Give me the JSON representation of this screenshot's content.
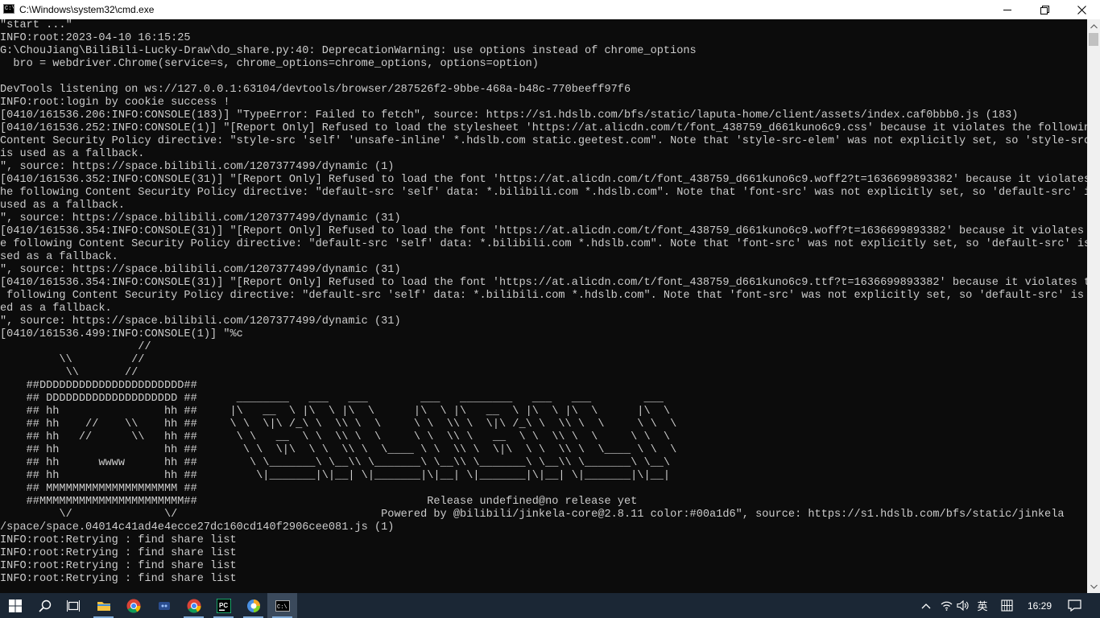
{
  "window": {
    "title": "C:\\Windows\\system32\\cmd.exe",
    "icon": "cmd-console-icon",
    "icon_text": "C:\\"
  },
  "console": {
    "text_color": "#cccccc",
    "background": "#0c0c0c",
    "lines": [
      "\"start ...\"",
      "INFO:root:2023-04-10 16:15:25",
      "G:\\ChouJiang\\BiliBili-Lucky-Draw\\do_share.py:40: DeprecationWarning: use options instead of chrome_options",
      "  bro = webdriver.Chrome(service=s, chrome_options=chrome_options, options=option)",
      "",
      "DevTools listening on ws://127.0.0.1:63104/devtools/browser/287526f2-9bbe-468a-b48c-770beeff97f6",
      "INFO:root:login by cookie success !",
      "[0410/161536.206:INFO:CONSOLE(183)] \"TypeError: Failed to fetch\", source: https://s1.hdslb.com/bfs/static/laputa-home/client/assets/index.caf0bbb0.js (183)",
      "[0410/161536.252:INFO:CONSOLE(1)] \"[Report Only] Refused to load the stylesheet 'https://at.alicdn.com/t/font_438759_d661kuno6c9.css' because it violates the following",
      "Content Security Policy directive: \"style-src 'self' 'unsafe-inline' *.hdslb.com static.geetest.com\". Note that 'style-src-elem' was not explicitly set, so 'style-src'",
      "is used as a fallback.",
      "\", source: https://space.bilibili.com/1207377499/dynamic (1)",
      "[0410/161536.352:INFO:CONSOLE(31)] \"[Report Only] Refused to load the font 'https://at.alicdn.com/t/font_438759_d661kuno6c9.woff2?t=1636699893382' because it violates t",
      "he following Content Security Policy directive: \"default-src 'self' data: *.bilibili.com *.hdslb.com\". Note that 'font-src' was not explicitly set, so 'default-src' is",
      "used as a fallback.",
      "\", source: https://space.bilibili.com/1207377499/dynamic (31)",
      "[0410/161536.354:INFO:CONSOLE(31)] \"[Report Only] Refused to load the font 'https://at.alicdn.com/t/font_438759_d661kuno6c9.woff?t=1636699893382' because it violates th",
      "e following Content Security Policy directive: \"default-src 'self' data: *.bilibili.com *.hdslb.com\". Note that 'font-src' was not explicitly set, so 'default-src' is u",
      "sed as a fallback.",
      "\", source: https://space.bilibili.com/1207377499/dynamic (31)",
      "[0410/161536.354:INFO:CONSOLE(31)] \"[Report Only] Refused to load the font 'https://at.alicdn.com/t/font_438759_d661kuno6c9.ttf?t=1636699893382' because it violates the",
      " following Content Security Policy directive: \"default-src 'self' data: *.bilibili.com *.hdslb.com\". Note that 'font-src' was not explicitly set, so 'default-src' is us",
      "ed as a fallback.",
      "\", source: https://space.bilibili.com/1207377499/dynamic (31)",
      "[0410/161536.499:INFO:CONSOLE(1)] \"%c",
      "                     //",
      "         \\\\         //",
      "          \\\\       //",
      "    ##DDDDDDDDDDDDDDDDDDDDDD##",
      "    ## DDDDDDDDDDDDDDDDDDDD ##      ________   ___   ___        ___   ________   ___   ___        ___",
      "    ## hh                hh ##     |\\   __  \\ |\\  \\ |\\  \\      |\\  \\ |\\   __  \\ |\\  \\ |\\  \\      |\\  \\",
      "    ## hh    //    \\\\    hh ##     \\ \\  \\|\\ /_\\ \\  \\\\ \\  \\     \\ \\  \\\\ \\  \\|\\ /_\\ \\  \\\\ \\  \\     \\ \\  \\",
      "    ## hh   //      \\\\   hh ##      \\ \\   __  \\ \\  \\\\ \\  \\     \\ \\  \\\\ \\   __  \\ \\  \\\\ \\  \\     \\ \\  \\",
      "    ## hh                hh ##       \\ \\  \\|\\  \\ \\  \\\\ \\  \\____ \\ \\  \\\\ \\  \\|\\  \\ \\  \\\\ \\  \\____ \\ \\  \\",
      "    ## hh      wwww      hh ##        \\ \\_______\\ \\__\\\\ \\_______\\ \\__\\\\ \\_______\\ \\__\\\\ \\_______\\ \\__\\",
      "    ## hh                hh ##         \\|_______|\\|__| \\|_______|\\|__| \\|_______|\\|__| \\|_______|\\|__|",
      "    ## MMMMMMMMMMMMMMMMMMMM ##",
      "    ##MMMMMMMMMMMMMMMMMMMMMM##                                   Release undefined@no release yet",
      "         \\/              \\/                               Powered by @bilibili/jinkela-core@2.8.11 color:#00a1d6\", source: https://s1.hdslb.com/bfs/static/jinkela",
      "/space/space.04014c41ad4e4ecce27dc160cd140f2906cee081.js (1)",
      "INFO:root:Retrying : find share list",
      "INFO:root:Retrying : find share list",
      "INFO:root:Retrying : find share list",
      "INFO:root:Retrying : find share list"
    ]
  },
  "scrollbar": {
    "position_fraction": 0.0
  },
  "taskbar": {
    "items": [
      {
        "name": "start-button",
        "icon": "windows-logo-icon",
        "active": false
      },
      {
        "name": "search-button",
        "icon": "search-icon",
        "active": false
      },
      {
        "name": "task-view-button",
        "icon": "task-view-icon",
        "active": false
      },
      {
        "name": "file-explorer-button",
        "icon": "folder-icon",
        "active": false
      },
      {
        "name": "chrome-button",
        "icon": "chrome-icon",
        "active": false
      },
      {
        "name": "app-button",
        "icon": "app-icon",
        "active": false
      },
      {
        "name": "chrome-running-button",
        "icon": "chrome-icon",
        "active": false
      },
      {
        "name": "pycharm-button",
        "icon": "pycharm-icon",
        "active": false
      },
      {
        "name": "browser-button",
        "icon": "browser-icon",
        "active": false
      },
      {
        "name": "cmd-button",
        "icon": "cmd-icon",
        "active": true
      }
    ],
    "tray": {
      "ime": "英",
      "clock": "16:29"
    }
  }
}
